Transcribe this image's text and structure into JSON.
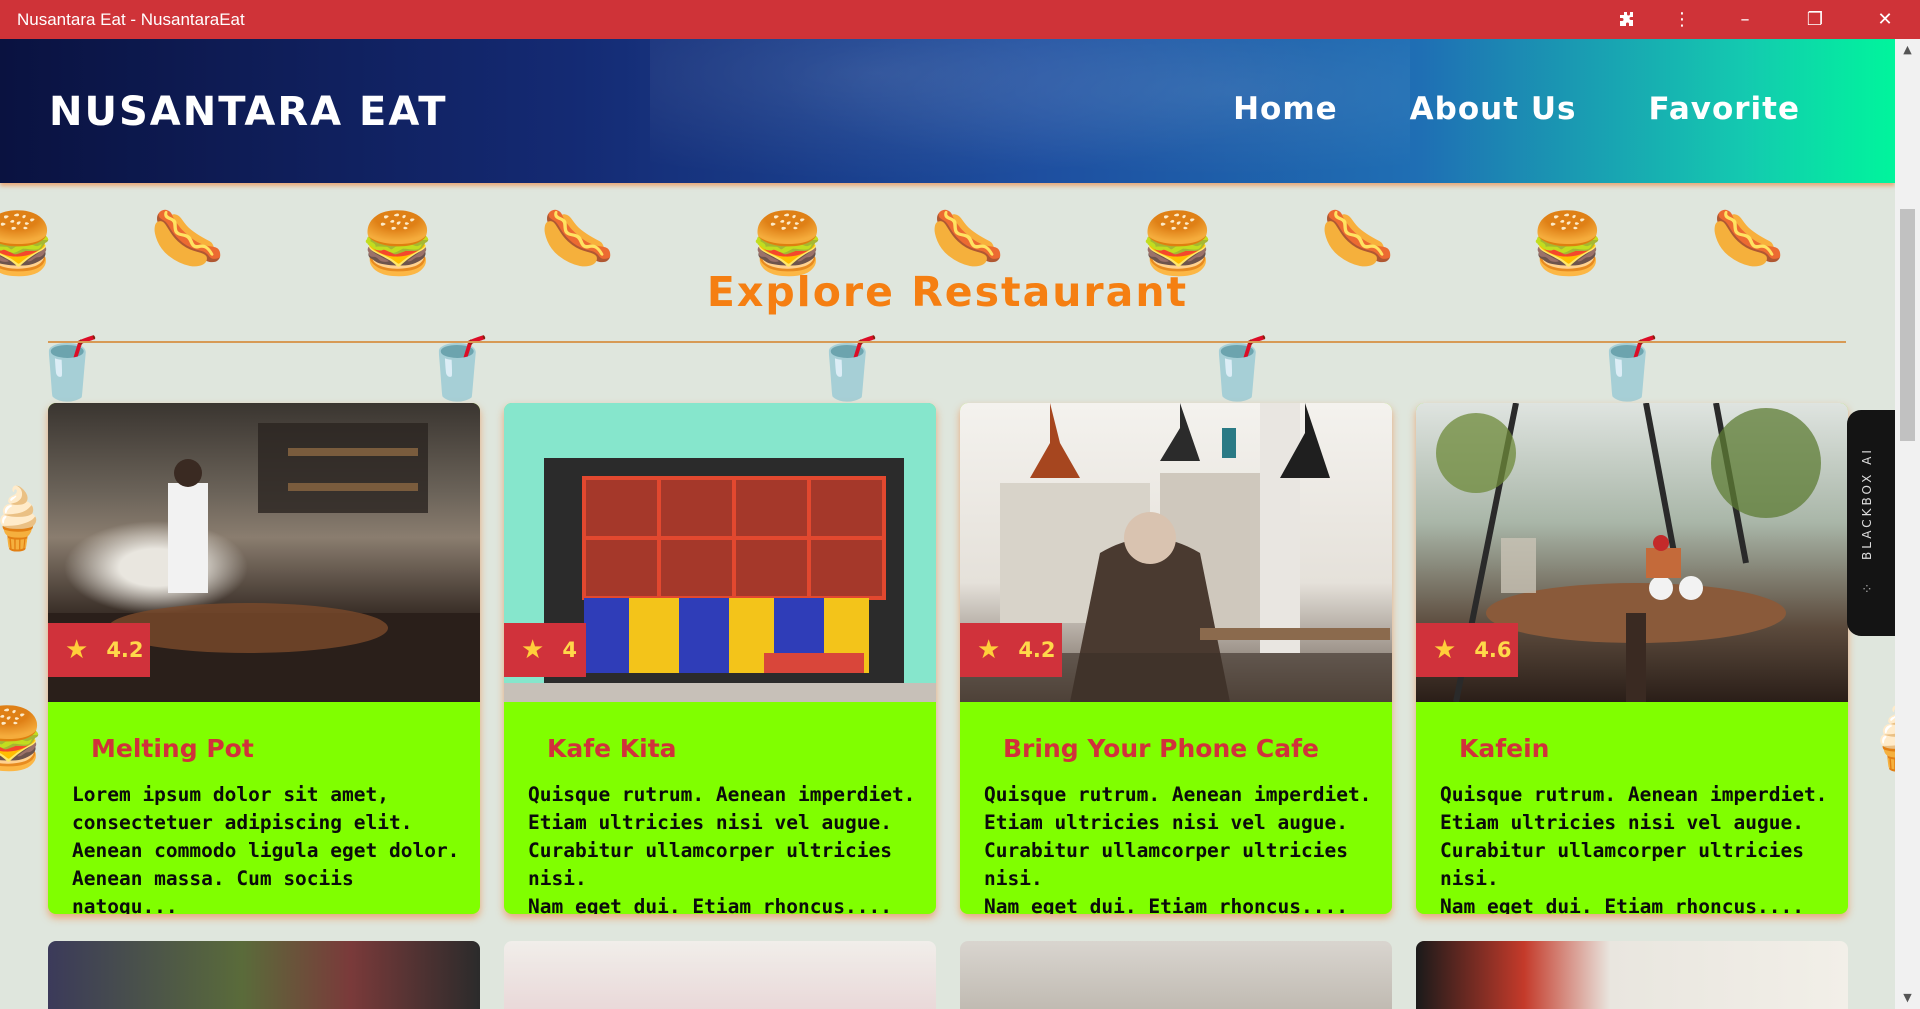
{
  "window": {
    "title": "Nusantara Eat - NusantaraEat",
    "icons": [
      "extension-icon",
      "menu-dots-icon",
      "minimize-icon",
      "restore-icon",
      "close-icon"
    ]
  },
  "header": {
    "brand": "NUSANTARA EAT",
    "nav": [
      {
        "label": "Home"
      },
      {
        "label": "About Us"
      },
      {
        "label": "Favorite"
      }
    ]
  },
  "side_widget": {
    "label": "BLACKBOX AI"
  },
  "section": {
    "title": "Explore Restaurant"
  },
  "restaurants": [
    {
      "name": "Melting Pot",
      "rating": "4.2",
      "description": "Lorem ipsum dolor sit amet,\nconsectetuer adipiscing elit.\nAenean commodo ligula eget dolor.\nAenean massa. Cum sociis natoqu..."
    },
    {
      "name": "Kafe Kita",
      "rating": "4",
      "description": "Quisque rutrum. Aenean imperdiet.\nEtiam ultricies nisi vel augue.\nCurabitur ullamcorper ultricies nisi.\nNam eget dui. Etiam rhoncus...."
    },
    {
      "name": "Bring Your Phone Cafe",
      "rating": "4.2",
      "description": "Quisque rutrum. Aenean imperdiet.\nEtiam ultricies nisi vel augue.\nCurabitur ullamcorper ultricies nisi.\nNam eget dui. Etiam rhoncus...."
    },
    {
      "name": "Kafein",
      "rating": "4.6",
      "description": "Quisque rutrum. Aenean imperdiet.\nEtiam ultricies nisi vel augue.\nCurabitur ullamcorper ultricies nisi.\nNam eget dui. Etiam rhoncus...."
    }
  ],
  "colors": {
    "titlebar": "#cf3338",
    "accent_orange": "#f57f12",
    "card_bg": "#80ff00",
    "rating_bg": "#d0323b",
    "name_color": "#d0323b"
  }
}
